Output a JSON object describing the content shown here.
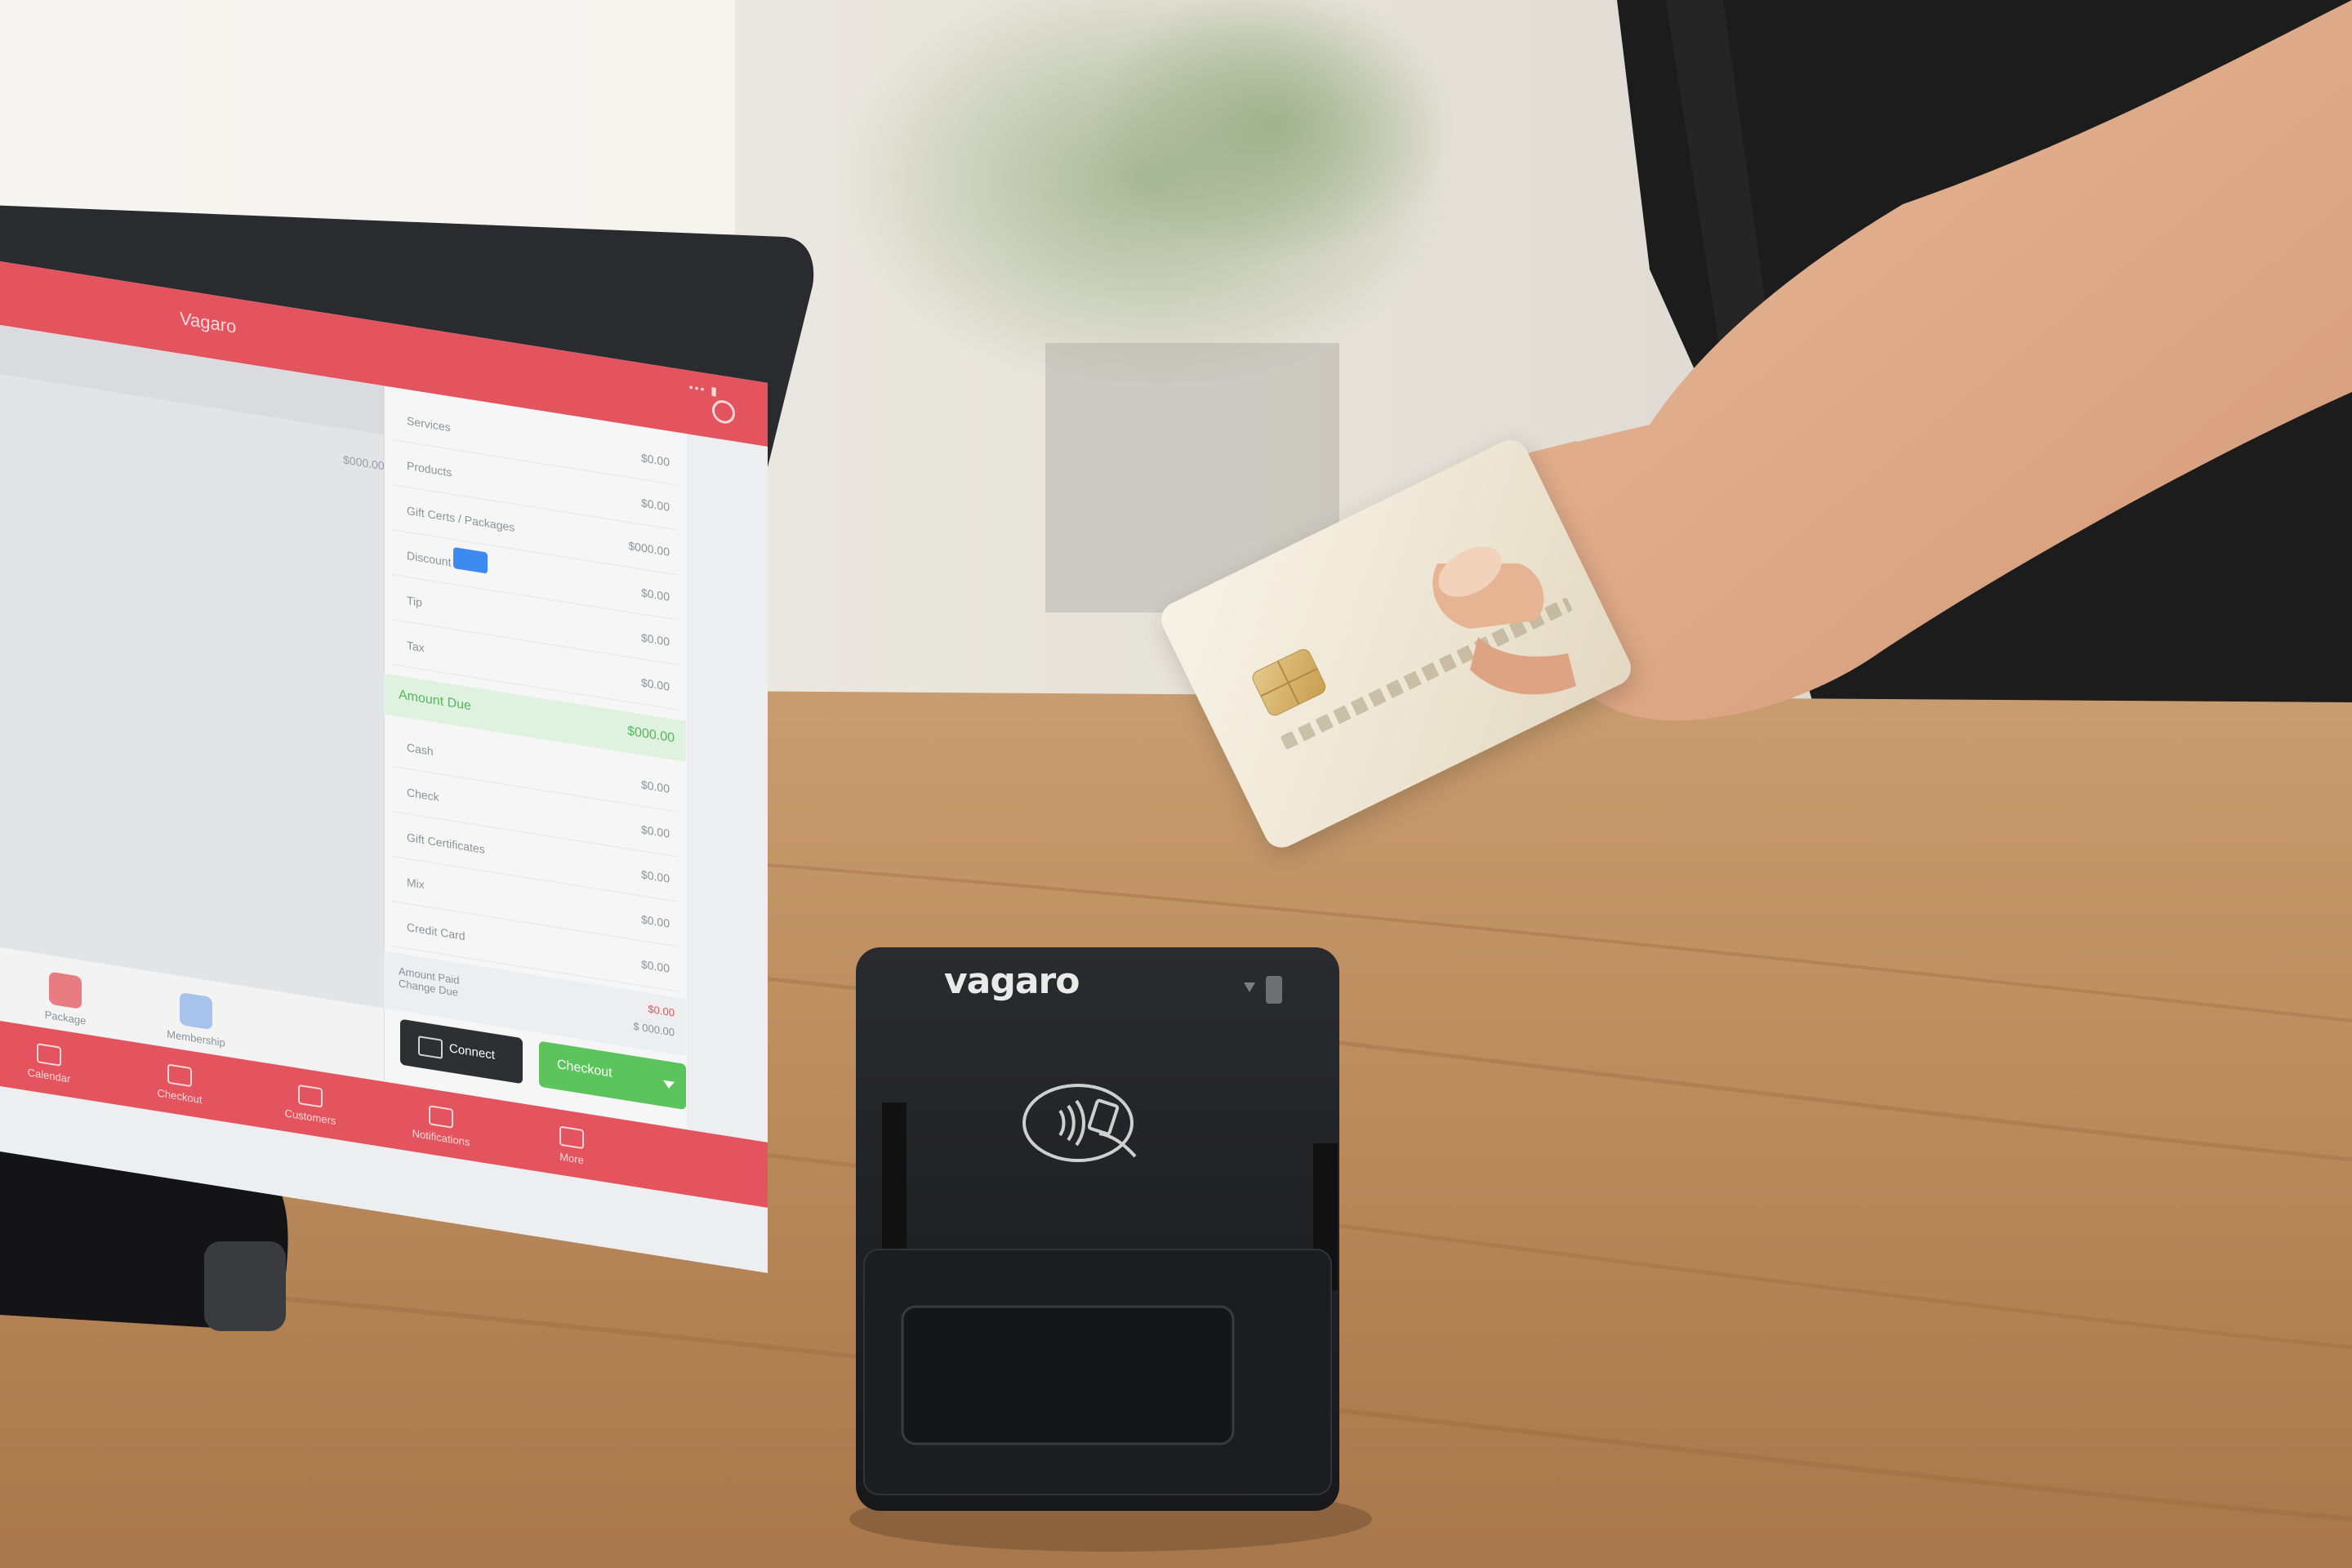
{
  "reader": {
    "brand": "vagaro",
    "contactless_icon": "contactless-payment-icon"
  },
  "pos": {
    "header_title": "Vagaro",
    "status_text": "••• ▮",
    "left_amount": "$000.00",
    "rows": [
      {
        "label": "Services",
        "value": "$0.00"
      },
      {
        "label": "Products",
        "value": "$0.00"
      },
      {
        "label": "Gift Certs / Packages",
        "value": "$000.00"
      },
      {
        "label": "Discount",
        "value": "$0.00"
      },
      {
        "label": "Tip",
        "value": "$0.00"
      },
      {
        "label": "Tax",
        "value": "$0.00"
      }
    ],
    "amount_due": {
      "label": "Amount Due",
      "value": "$000.00"
    },
    "payment_rows": [
      {
        "label": "Cash",
        "value": "$0.00"
      },
      {
        "label": "Check",
        "value": "$0.00"
      },
      {
        "label": "Gift Certificates",
        "value": "$0.00"
      },
      {
        "label": "Mix",
        "value": "$0.00"
      },
      {
        "label": "Credit Card",
        "value": "$0.00"
      }
    ],
    "remaining": {
      "label": "Amount Paid\nChange Due",
      "due": "$0.00",
      "balance": "$ 000.00"
    },
    "tiles": [
      {
        "label": "Package"
      },
      {
        "label": "Membership"
      }
    ],
    "connect_label": "Connect",
    "checkout_label": "Checkout",
    "tabs": [
      {
        "label": "Calendar"
      },
      {
        "label": "Checkout"
      },
      {
        "label": "Customers"
      },
      {
        "label": "Notifications"
      },
      {
        "label": "More"
      }
    ]
  },
  "colors": {
    "brand_red": "#e4545e",
    "checkout_green": "#5cc45c",
    "reader_black": "#1d1e20",
    "wood": "#b98a5c",
    "card": "#f3ecdc"
  }
}
